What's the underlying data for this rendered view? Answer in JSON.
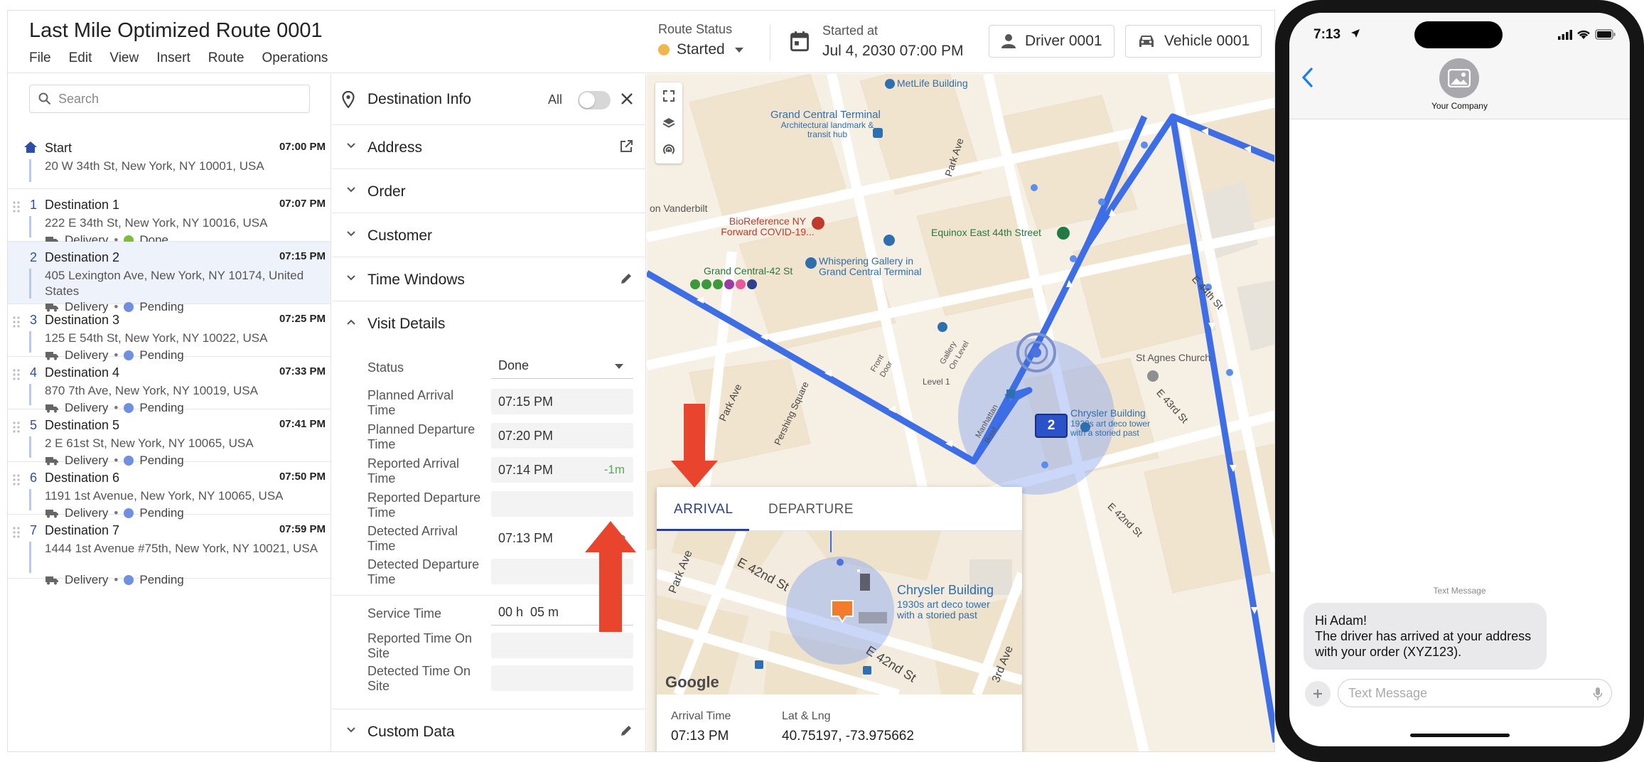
{
  "header": {
    "title": "Last Mile Optimized Route 0001",
    "menu": [
      "File",
      "Edit",
      "View",
      "Insert",
      "Route",
      "Operations"
    ],
    "route_status_label": "Route Status",
    "route_status_value": "Started",
    "started_label": "Started at",
    "started_value": "Jul 4, 2030 07:00 PM",
    "driver_label": "Driver 0001",
    "vehicle_label": "Vehicle 0001",
    "colors": {
      "status_started": "#f2b64e"
    }
  },
  "search": {
    "placeholder": "Search"
  },
  "stops": [
    {
      "num": "",
      "name": "Start",
      "time": "07:00 PM",
      "address": "20 W 34th St, New York, NY 10001, USA"
    },
    {
      "num": "1",
      "name": "Destination 1",
      "time": "07:07 PM",
      "address": "222 E 34th St, New York, NY 10016, USA",
      "type": "Delivery",
      "status": "Done",
      "status_color": "#7cbd3c"
    },
    {
      "num": "2",
      "name": "Destination 2",
      "time": "07:15 PM",
      "address": "405 Lexington Ave, New York, NY 10174, United States",
      "type": "Delivery",
      "status": "Pending",
      "status_color": "#6f8fe0"
    },
    {
      "num": "3",
      "name": "Destination 3",
      "time": "07:25 PM",
      "address": "125 E 54th St, New York, NY 10022, USA",
      "type": "Delivery",
      "status": "Pending",
      "status_color": "#6f8fe0"
    },
    {
      "num": "4",
      "name": "Destination 4",
      "time": "07:33 PM",
      "address": "870 7th Ave, New York, NY 10019, USA",
      "type": "Delivery",
      "status": "Pending",
      "status_color": "#6f8fe0"
    },
    {
      "num": "5",
      "name": "Destination 5",
      "time": "07:41 PM",
      "address": "2 E 61st St, New York, NY 10065, USA",
      "type": "Delivery",
      "status": "Pending",
      "status_color": "#6f8fe0"
    },
    {
      "num": "6",
      "name": "Destination 6",
      "time": "07:50 PM",
      "address": "1191 1st Avenue, New York, NY 10065, USA",
      "type": "Delivery",
      "status": "Pending",
      "status_color": "#6f8fe0"
    },
    {
      "num": "7",
      "name": "Destination 7",
      "time": "07:59 PM",
      "address": "1444 1st Avenue #75th, New York, NY 10021, USA",
      "type": "Delivery",
      "status": "Pending",
      "status_color": "#6f8fe0"
    }
  ],
  "panel": {
    "title": "Destination Info",
    "all_label": "All",
    "sections": {
      "address": "Address",
      "order": "Order",
      "customer": "Customer",
      "time_windows": "Time Windows",
      "visit_details": "Visit Details",
      "custom_data": "Custom Data"
    },
    "fields": {
      "status_label": "Status",
      "status_value": "Done",
      "planned_arrival_label": "Planned Arrival Time",
      "planned_arrival_value": "07:15 PM",
      "planned_departure_label": "Planned Departure Time",
      "planned_departure_value": "07:20 PM",
      "reported_arrival_label": "Reported Arrival Time",
      "reported_arrival_value": "07:14 PM",
      "reported_arrival_delta": "-1m",
      "reported_departure_label": "Reported Departure Time",
      "reported_departure_value": "",
      "detected_arrival_label": "Detected Arrival Time",
      "detected_arrival_value": "07:13 PM",
      "detected_departure_label": "Detected Departure Time",
      "detected_departure_value": "",
      "service_time_label": "Service Time",
      "service_time_value": "00 h  05 m",
      "reported_onsite_label": "Reported Time On Site",
      "reported_onsite_value": "",
      "detected_onsite_label": "Detected Time On Site",
      "detected_onsite_value": ""
    }
  },
  "map": {
    "labels": {
      "metlife": "MetLife Building",
      "grand_central": "Grand Central Terminal",
      "grand_central_sub": "Architectural landmark & transit hub",
      "park_ave": "Park Ave",
      "vanderbilt": "on Vanderbilt",
      "bioreference": "BioReference NY Forward COVID-19...",
      "equinox": "Equinox East 44th Street",
      "whispering": "Whispering Gallery in Grand Central Terminal",
      "gc42": "Grand Central-42 St",
      "e44": "E 44th St",
      "st_agnes": "St Agnes Church",
      "e43": "E 43rd St",
      "level1": "Level 1",
      "chrysler": "Chrysler Building",
      "chrysler_sub": "1930s art deco tower with a storied past",
      "park_ave2": "Park Ave",
      "pershing": "Pershing Square",
      "e42": "E 42nd St",
      "front_door": "Front Door",
      "gallery_level": "Gallery On Level",
      "manhattan": "Manhattan Bowl..."
    },
    "marker_number": "2",
    "popup": {
      "tab_arrival": "ARRIVAL",
      "tab_departure": "DEPARTURE",
      "park_ave": "Park Ave",
      "e42_a": "E 42nd St",
      "e42_b": "E 42nd St",
      "third_ave": "3rd Ave",
      "chrysler": "Chrysler Building",
      "chrysler_sub": "1930s art deco tower with a storied past",
      "google": "Google",
      "arrival_time_label": "Arrival Time",
      "arrival_time_value": "07:13 PM",
      "latlng_label": "Lat & Lng",
      "latlng_value": "40.75197, -73.975662"
    },
    "colors": {
      "route": "#3d6ee6",
      "geofence": "#8aa6f0",
      "arrow": "#e8442e"
    }
  },
  "phone": {
    "time": "7:13",
    "company": "Your Company",
    "message_meta": "Text Message",
    "message_line1": "Hi Adam!",
    "message_line2": "The driver has arrived at your address with your order (XYZ123).",
    "input_placeholder": "Text Message"
  }
}
